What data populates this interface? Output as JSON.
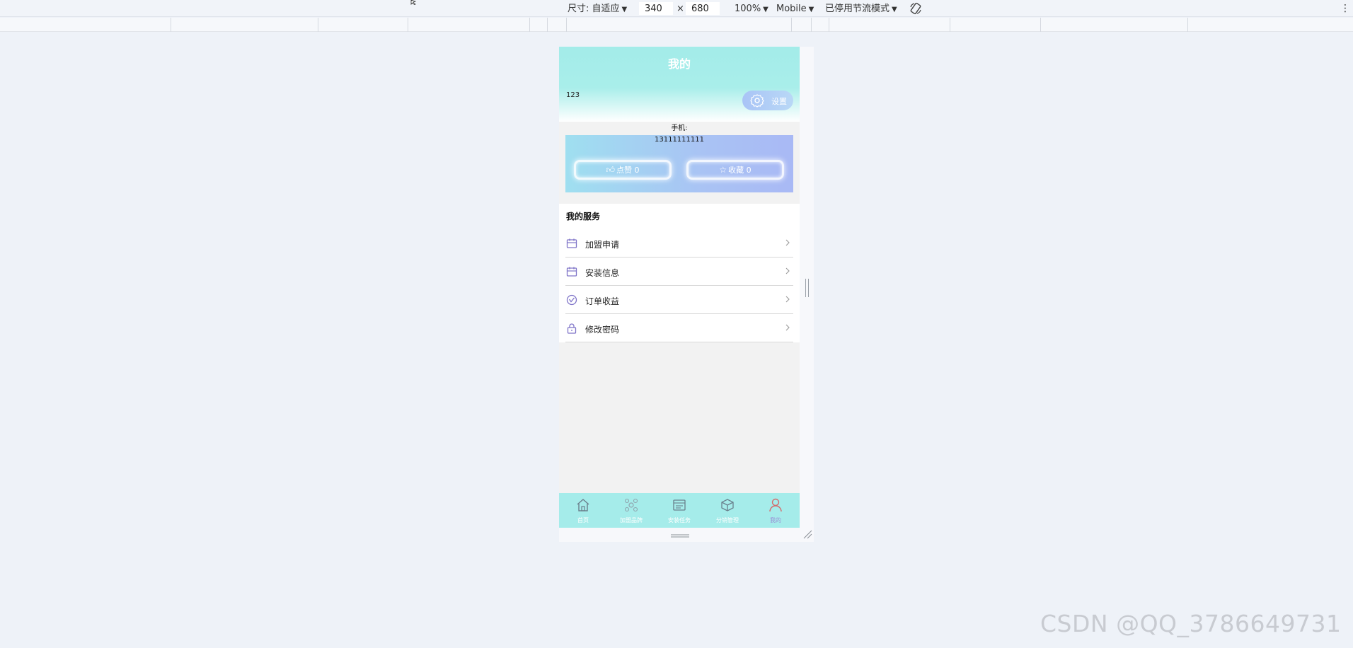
{
  "devtools": {
    "dimensions_label": "尺寸: 自适应",
    "width_value": "340",
    "times_sign": "×",
    "height_value": "680",
    "zoom": "100%",
    "device_type": "Mobile",
    "throttle": "已停用节流模式"
  },
  "app": {
    "title": "我的",
    "username": "123",
    "settings_label": "设置",
    "phone_label": "手机:",
    "phone_number": "13111111111",
    "stats": {
      "like_label": "点赞 0",
      "favorite_label": "收藏 0"
    },
    "services": {
      "title": "我的服务",
      "items": [
        {
          "label": "加盟申请",
          "icon": "calendar-icon"
        },
        {
          "label": "安装信息",
          "icon": "calendar-icon"
        },
        {
          "label": "订单收益",
          "icon": "chart-icon"
        },
        {
          "label": "修改密码",
          "icon": "lock-icon"
        }
      ]
    },
    "tabs": [
      {
        "label": "首页",
        "icon": "home-icon"
      },
      {
        "label": "加盟品牌",
        "icon": "brand-icon"
      },
      {
        "label": "安装任务",
        "icon": "task-icon"
      },
      {
        "label": "分销管理",
        "icon": "box-icon"
      },
      {
        "label": "我的",
        "icon": "user-icon",
        "active": true
      }
    ]
  },
  "watermark": "CSDN @QQ_3786649731",
  "colors": {
    "header_top": "#a3ece9",
    "tabbar": "#a5ecea",
    "card_end": "#a9b9f5",
    "icon_purple": "#7f74c8"
  }
}
